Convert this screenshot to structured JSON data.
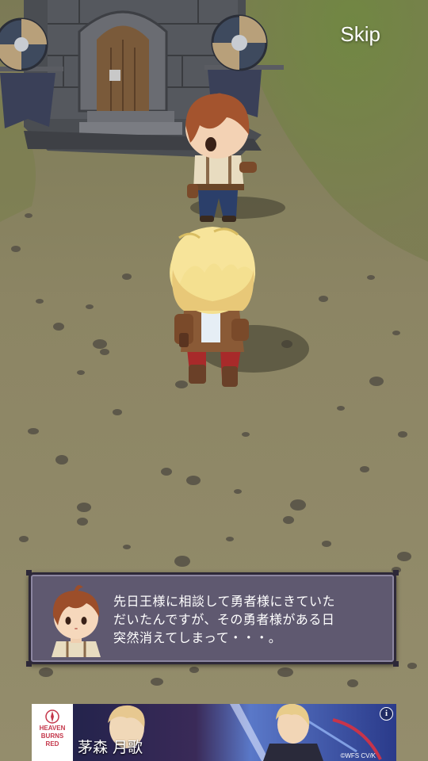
{
  "hud": {
    "skip_label": "Skip"
  },
  "dialog": {
    "speaker_portrait": "brown-haired-villager-portrait",
    "lines": [
      "先日王様に相談して勇者様にきていた",
      "だいたんですが、その勇者様がある日",
      "突然消えてしまって・・・。"
    ]
  },
  "ad": {
    "logo_lines": [
      "HEAVEN",
      "BURNS",
      "RED"
    ],
    "character_name": "茅森 月歌",
    "copyright": "©WFS CV/K",
    "info_icon": "i"
  },
  "colors": {
    "ground": "#8a8462",
    "dialog_bg": "#5f5970",
    "dialog_border": "#2d2838",
    "text": "#ffffff"
  }
}
